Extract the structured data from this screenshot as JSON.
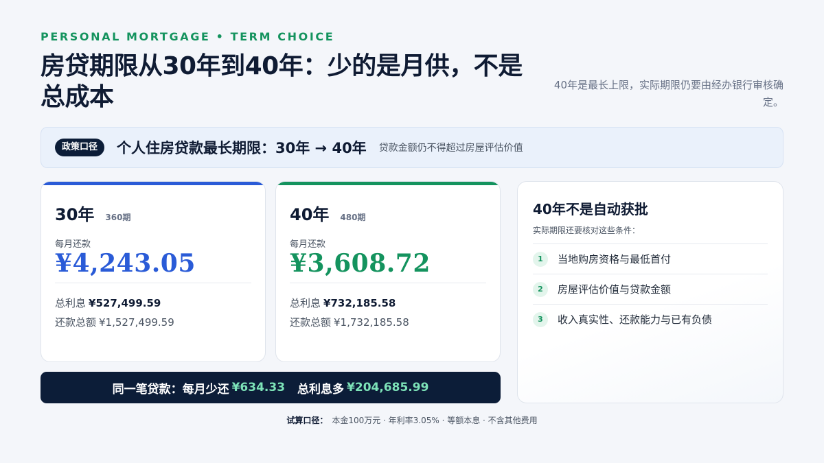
{
  "header": {
    "eyebrow": "PERSONAL MORTGAGE • TERM CHOICE",
    "title": "房贷期限从30年到40年：少的是月供，不是总成本",
    "side_note": "40年是最长上限，实际期限仍要由经办银行审核确定。"
  },
  "policy": {
    "pill": "政策口径",
    "title": "个人住房贷款最长期限：30年 → 40年",
    "sub": "贷款金额仍不得超过房屋评估价值"
  },
  "cards": [
    {
      "years": "30年",
      "periods": "360期",
      "monthly_label": "每月还款",
      "monthly_amount": "¥4,243.05",
      "interest_label": "总利息",
      "interest_value": "¥527,499.59",
      "total_label": "还款总额",
      "total_value": "¥1,527,499.59",
      "accent": "#2a5bd7"
    },
    {
      "years": "40年",
      "periods": "480期",
      "monthly_label": "每月还款",
      "monthly_amount": "¥3,608.72",
      "interest_label": "总利息",
      "interest_value": "¥732,185.58",
      "total_label": "还款总额",
      "total_value": "¥1,732,185.58",
      "accent": "#14935e"
    }
  ],
  "difference": {
    "prefix": "同一笔贷款：每月少还",
    "monthly_less": "¥634.33",
    "interest_label": "总利息多",
    "interest_more": "¥204,685.99"
  },
  "approval": {
    "title": "40年不是自动获批",
    "subtitle": "实际期限还要核对这些条件：",
    "conditions": [
      {
        "num": "1",
        "text": "当地购房资格与最低首付"
      },
      {
        "num": "2",
        "text": "房屋评估价值与贷款金额"
      },
      {
        "num": "3",
        "text": "收入真实性、还款能力与已有负债"
      }
    ]
  },
  "footnote": {
    "label": "试算口径：",
    "text": "本金100万元 · 年利率3.05% · 等额本息 · 不含其他费用"
  },
  "colors": {
    "navy": "#0c1d38",
    "blue_accent": "#2a5bd7",
    "green_accent": "#14935e",
    "highlight": "#7de3b8"
  }
}
